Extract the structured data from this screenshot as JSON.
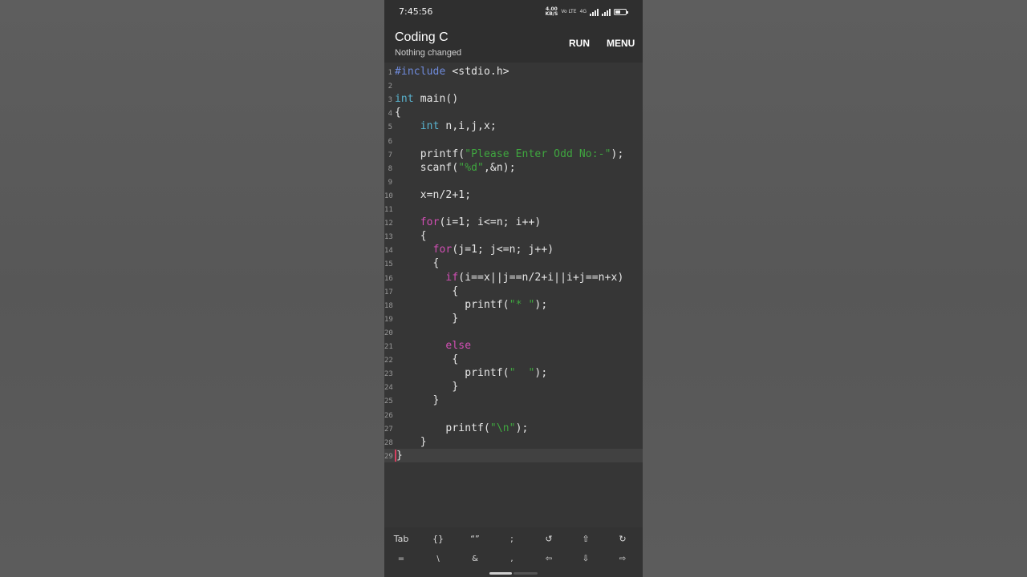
{
  "status": {
    "time": "7:45:56",
    "net_speed_value": "4.00",
    "net_speed_unit": "KB/S",
    "volte": "Vo LTE",
    "network": "4G"
  },
  "app": {
    "title": "Coding C",
    "subtitle": "Nothing changed",
    "run_label": "RUN",
    "menu_label": "MENU"
  },
  "editor": {
    "current_line": 29,
    "lines": [
      {
        "n": "1",
        "segments": [
          {
            "t": "#include",
            "c": "kw-pre"
          },
          {
            "t": " <stdio.h>"
          }
        ]
      },
      {
        "n": "2",
        "segments": []
      },
      {
        "n": "3",
        "segments": [
          {
            "t": "int",
            "c": "kw-type"
          },
          {
            "t": " main()"
          }
        ]
      },
      {
        "n": "4",
        "segments": [
          {
            "t": "{"
          }
        ]
      },
      {
        "n": "5",
        "segments": [
          {
            "t": "    "
          },
          {
            "t": "int",
            "c": "kw-type"
          },
          {
            "t": " n,i,j,x;"
          }
        ]
      },
      {
        "n": "6",
        "segments": []
      },
      {
        "n": "7",
        "segments": [
          {
            "t": "    printf("
          },
          {
            "t": "\"Please Enter Odd No:-\"",
            "c": "str"
          },
          {
            "t": ");"
          }
        ]
      },
      {
        "n": "8",
        "segments": [
          {
            "t": "    scanf("
          },
          {
            "t": "\"%d\"",
            "c": "str"
          },
          {
            "t": ",&n);"
          }
        ]
      },
      {
        "n": "9",
        "segments": []
      },
      {
        "n": "10",
        "segments": [
          {
            "t": "    x=n/2+1;"
          }
        ]
      },
      {
        "n": "11",
        "segments": []
      },
      {
        "n": "12",
        "segments": [
          {
            "t": "    "
          },
          {
            "t": "for",
            "c": "kw-ctrl"
          },
          {
            "t": "(i=1; i<=n; i++)"
          }
        ]
      },
      {
        "n": "13",
        "segments": [
          {
            "t": "    {"
          }
        ]
      },
      {
        "n": "14",
        "segments": [
          {
            "t": "      "
          },
          {
            "t": "for",
            "c": "kw-ctrl"
          },
          {
            "t": "(j=1; j<=n; j++)"
          }
        ]
      },
      {
        "n": "15",
        "segments": [
          {
            "t": "      {"
          }
        ]
      },
      {
        "n": "16",
        "segments": [
          {
            "t": "        "
          },
          {
            "t": "if",
            "c": "kw-ctrl"
          },
          {
            "t": "(i==x||j==n/2+i||i+j==n+x)"
          }
        ]
      },
      {
        "n": "17",
        "segments": [
          {
            "t": "         {"
          }
        ]
      },
      {
        "n": "18",
        "segments": [
          {
            "t": "           printf("
          },
          {
            "t": "\"* \"",
            "c": "str"
          },
          {
            "t": ");"
          }
        ]
      },
      {
        "n": "19",
        "segments": [
          {
            "t": "         }"
          }
        ]
      },
      {
        "n": "20",
        "segments": []
      },
      {
        "n": "21",
        "segments": [
          {
            "t": "        "
          },
          {
            "t": "else",
            "c": "kw-ctrl"
          }
        ]
      },
      {
        "n": "22",
        "segments": [
          {
            "t": "         {"
          }
        ]
      },
      {
        "n": "23",
        "segments": [
          {
            "t": "           printf("
          },
          {
            "t": "\"  \"",
            "c": "str"
          },
          {
            "t": ");"
          }
        ]
      },
      {
        "n": "24",
        "segments": [
          {
            "t": "         }"
          }
        ]
      },
      {
        "n": "25",
        "segments": [
          {
            "t": "      }"
          }
        ]
      },
      {
        "n": "26",
        "segments": []
      },
      {
        "n": "27",
        "segments": [
          {
            "t": "        printf("
          },
          {
            "t": "\"\\n\"",
            "c": "str"
          },
          {
            "t": ");"
          }
        ]
      },
      {
        "n": "28",
        "segments": [
          {
            "t": "    }"
          }
        ]
      },
      {
        "n": "29",
        "segments": [
          {
            "t": "}"
          }
        ]
      }
    ]
  },
  "keyboard": {
    "row1": [
      "Tab",
      "{}",
      "“”",
      ";",
      "↺",
      "⇧",
      "↻"
    ],
    "row2": [
      "=",
      "\\",
      "&",
      ",",
      "⇦",
      "⇩",
      "⇨"
    ]
  }
}
